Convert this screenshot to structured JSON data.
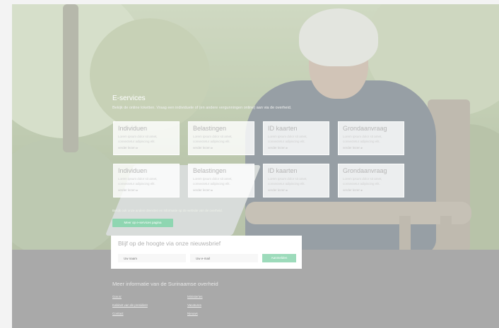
{
  "hero": {
    "title": "E-services",
    "subtitle": "Bekijk de online loketten. Vraag een individuele of (en andere vergunningen online) aan via de overheid."
  },
  "cards": [
    {
      "title": "Individuen",
      "text": "Lorem ipsum dolor sit amet, consectetur adipiscing elit.",
      "link": "verder lezen ▸"
    },
    {
      "title": "Belastingen",
      "text": "Lorem ipsum dolor sit amet, consectetur adipiscing elit.",
      "link": "verder lezen ▸"
    },
    {
      "title": "ID kaarten",
      "text": "Lorem ipsum dolor sit amet, consectetur adipiscing elit.",
      "link": "verder lezen ▸"
    },
    {
      "title": "Grondaanvraag",
      "text": "Lorem ipsum dolor sit amet, consectetur adipiscing elit.",
      "link": "verder lezen ▸"
    },
    {
      "title": "Individuen",
      "text": "Lorem ipsum dolor sit amet, consectetur adipiscing elit.",
      "link": "verder lezen ▸"
    },
    {
      "title": "Belastingen",
      "text": "Lorem ipsum dolor sit amet, consectetur adipiscing elit.",
      "link": "verder lezen ▸"
    },
    {
      "title": "ID kaarten",
      "text": "Lorem ipsum dolor sit amet, consectetur adipiscing elit.",
      "link": "verder lezen ▸"
    },
    {
      "title": "Grondaanvraag",
      "text": "Lorem ipsum dolor sit amet, consectetur adipiscing elit.",
      "link": "verder lezen ▸"
    }
  ],
  "more": {
    "fine_print": "Bekijk ook onze andere diensten en informatie op de website van de overheid.",
    "button_label": "Meer op e-services pagina"
  },
  "newsletter": {
    "title": "Blijf op de hoogte via onze nieuwsbrief",
    "name_placeholder": "Uw naam",
    "email_placeholder": "Uw e-mail",
    "button_label": "Aanmelden"
  },
  "footer": {
    "title": "Meer informatie van de Surinaamse overheid",
    "links_col1": [
      "Gov.sr",
      "Kabinet van de president",
      "Contact"
    ],
    "links_col2": [
      "Ministeries",
      "Vacatures",
      "Nieuws"
    ]
  },
  "colors": {
    "accent_green": "#8fd6b1",
    "footer_gray": "#a9a9a9"
  }
}
